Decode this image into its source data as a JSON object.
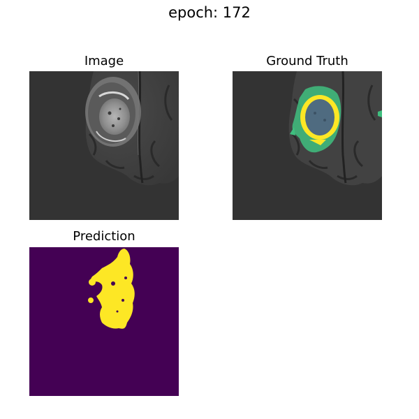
{
  "figure": {
    "suptitle": "epoch: 172"
  },
  "panels": [
    {
      "title": "Image",
      "content": "grayscale brain MRI slice with tumor"
    },
    {
      "title": "Ground Truth",
      "content": "MRI slice overlaid with segmentation mask"
    },
    {
      "title": "Prediction",
      "content": "predicted segmentation mask"
    }
  ],
  "colors": {
    "background": "#333333",
    "mask_background": "#440154",
    "mask_tumor": "#fde725",
    "mask_edema": "#3fbf7f",
    "tumor_core_overlay": "#4f6b80"
  }
}
